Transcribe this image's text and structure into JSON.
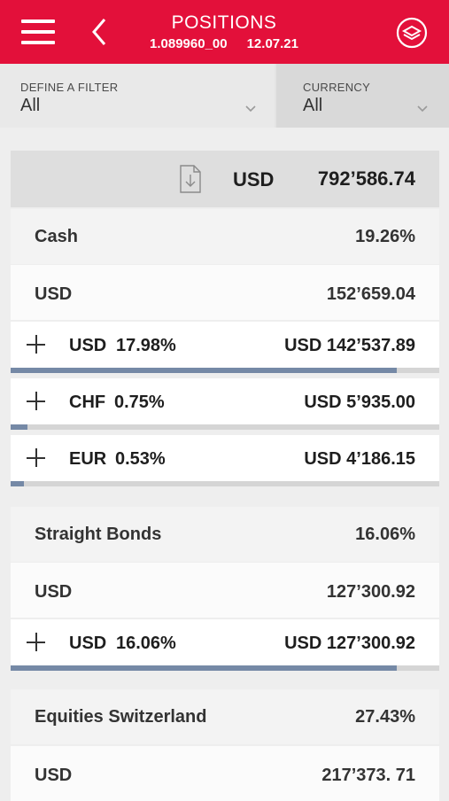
{
  "header": {
    "title": "POSITIONS",
    "portfolio_id": "1.089960_00",
    "date": "12.07.21"
  },
  "filters": [
    {
      "label": "DEFINE A FILTER",
      "value": "All"
    },
    {
      "label": "CURRENCY",
      "value": "All"
    }
  ],
  "total": {
    "currency": "USD",
    "amount": "792’586.74"
  },
  "categories": [
    {
      "name": "Cash",
      "percent": "19.26%",
      "currency": "USD",
      "amount": "152’659.04",
      "positions": [
        {
          "currency": "USD",
          "percent": "17.98%",
          "amount": "USD 142’537.89",
          "share": 0.9
        },
        {
          "currency": "CHF",
          "percent": "0.75%",
          "amount": "USD 5’935.00",
          "share": 0.04
        },
        {
          "currency": "EUR",
          "percent": "0.53%",
          "amount": "USD 4’186.15",
          "share": 0.03
        }
      ]
    },
    {
      "name": "Straight Bonds",
      "percent": "16.06%",
      "currency": "USD",
      "amount": "127’300.92",
      "positions": [
        {
          "currency": "USD",
          "percent": "16.06%",
          "amount": "USD 127’300.92",
          "share": 0.9
        }
      ]
    },
    {
      "name": "Equities Switzerland",
      "percent": "27.43%",
      "currency": "USD",
      "amount": "217’373. 71"
    }
  ],
  "colors": {
    "brand": "#e3103a",
    "bar_fill": "#7589a6",
    "bar_track": "#d5d5d5"
  },
  "icons": {
    "menu": "hamburger-icon",
    "back": "chevron-left-icon",
    "settings": "settings-circle-icon",
    "export": "document-download-icon",
    "expand": "plus-icon",
    "dropdown": "chevron-down-icon"
  }
}
